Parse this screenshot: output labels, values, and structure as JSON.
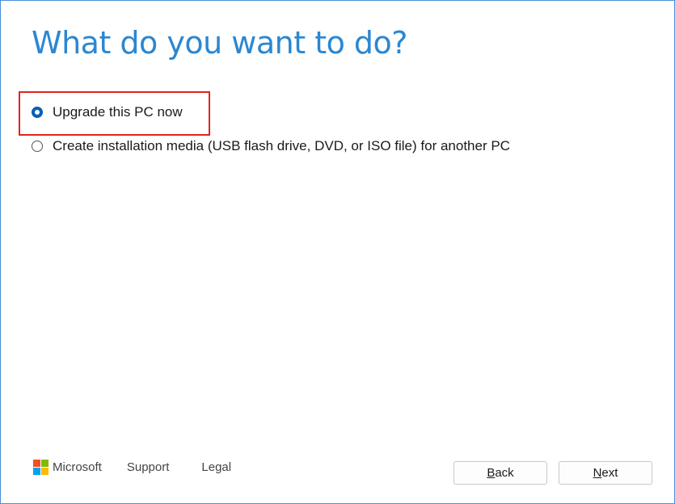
{
  "page": {
    "title": "What do you want to do?"
  },
  "options": [
    {
      "label": "Upgrade this PC now",
      "selected": true
    },
    {
      "label": "Create installation media (USB flash drive, DVD, or ISO file) for another PC",
      "selected": false
    }
  ],
  "footer": {
    "brand": "Microsoft",
    "support_link": "Support",
    "legal_link": "Legal",
    "logo_colors": [
      "#f25022",
      "#7fba00",
      "#00a4ef",
      "#ffb900"
    ]
  },
  "buttons": {
    "back": {
      "mnemonic": "B",
      "rest": "ack"
    },
    "next": {
      "mnemonic": "N",
      "rest": "ext"
    }
  },
  "colors": {
    "title": "#2b87d1",
    "radio_selected": "#0a5fb4",
    "highlight": "#e0231f"
  }
}
